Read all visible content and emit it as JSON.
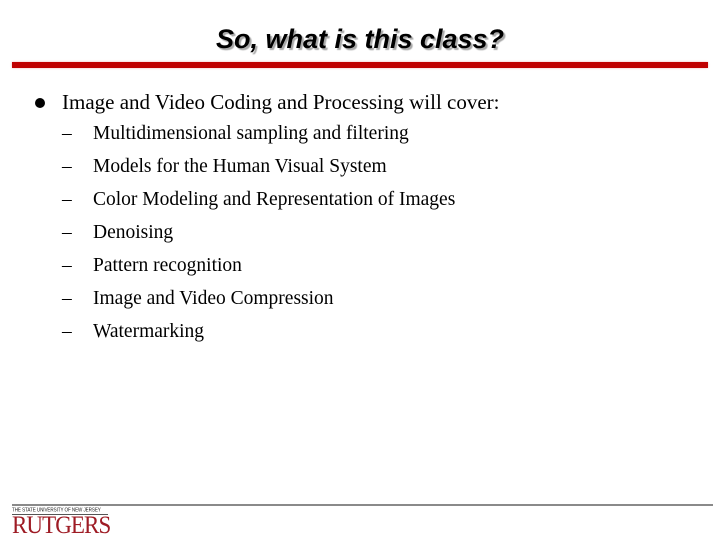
{
  "slide": {
    "title": "So, what is this class?",
    "colors": {
      "title_rule": "#c00000",
      "footer_rule": "#8a8a8a",
      "logo": "#9e1b24"
    },
    "main_item": {
      "bullet_icon": "filled-circle",
      "text": "Image and Video Coding and Processing will cover:"
    },
    "sub_items": [
      {
        "dash": "–",
        "text": "Multidimensional sampling and filtering"
      },
      {
        "dash": "–",
        "text": "Models for the Human Visual System"
      },
      {
        "dash": "–",
        "text": "Color Modeling and Representation of Images"
      },
      {
        "dash": "–",
        "text": "Denoising"
      },
      {
        "dash": "–",
        "text": "Pattern recognition"
      },
      {
        "dash": "–",
        "text": "Image and Video Compression"
      },
      {
        "dash": "–",
        "text": "Watermarking"
      }
    ],
    "footer": {
      "logo_tagline": "THE STATE UNIVERSITY OF NEW JERSEY",
      "logo_wordmark": "RUTGERS"
    }
  }
}
